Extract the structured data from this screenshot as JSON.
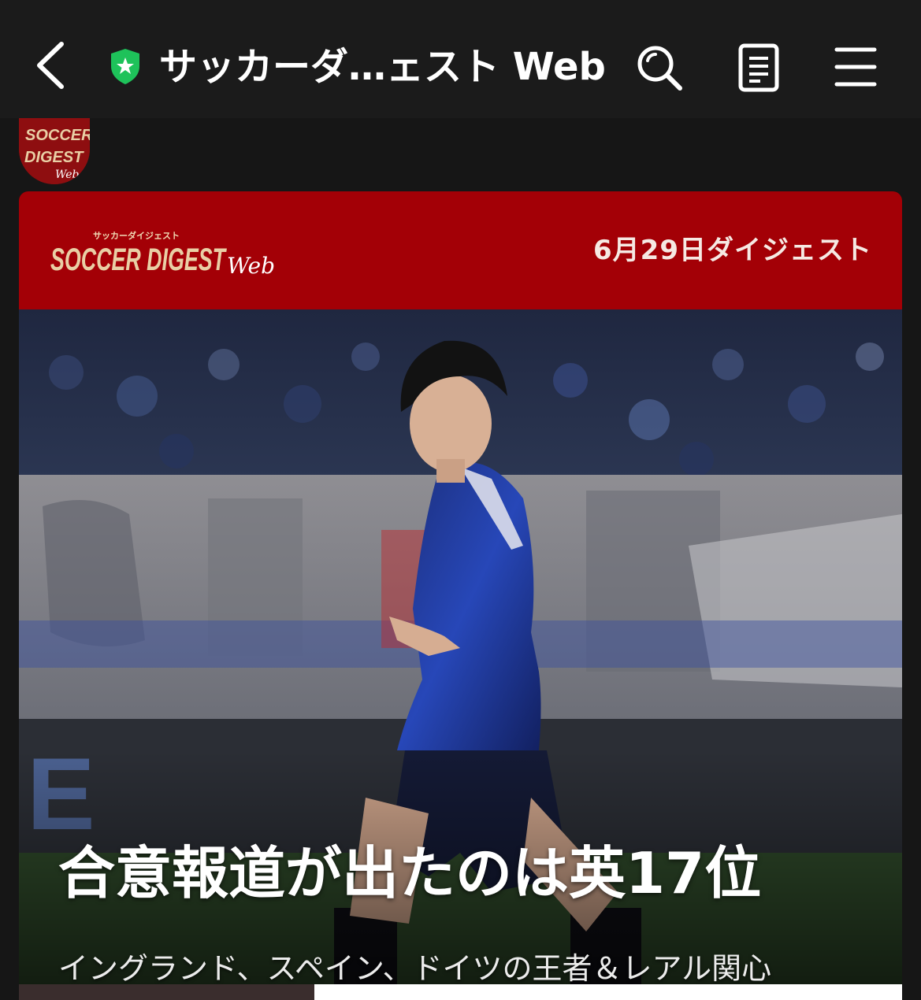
{
  "toolbar": {
    "title": "サッカーダ…ェスト Web",
    "icons": {
      "back": "chevron-left-icon",
      "verified": "shield-star-icon",
      "search": "search-icon",
      "reader": "reader-icon",
      "menu": "hamburger-menu-icon"
    }
  },
  "brand": {
    "logo_small": "SOCCER DIGEST Web",
    "logo_sub": "サッカーダイジェスト",
    "logo_web": "Web"
  },
  "card": {
    "date": "6月29日ダイジェスト",
    "headline": "合意報道が出たのは英17位",
    "subheadline": "イングランド、スペイン、ドイツの王者＆レアル関心"
  },
  "colors": {
    "topbar_bg": "#1b1b1b",
    "brand_red": "#a30006",
    "shield_green": "#1ec25a",
    "page_bg": "#161616"
  }
}
